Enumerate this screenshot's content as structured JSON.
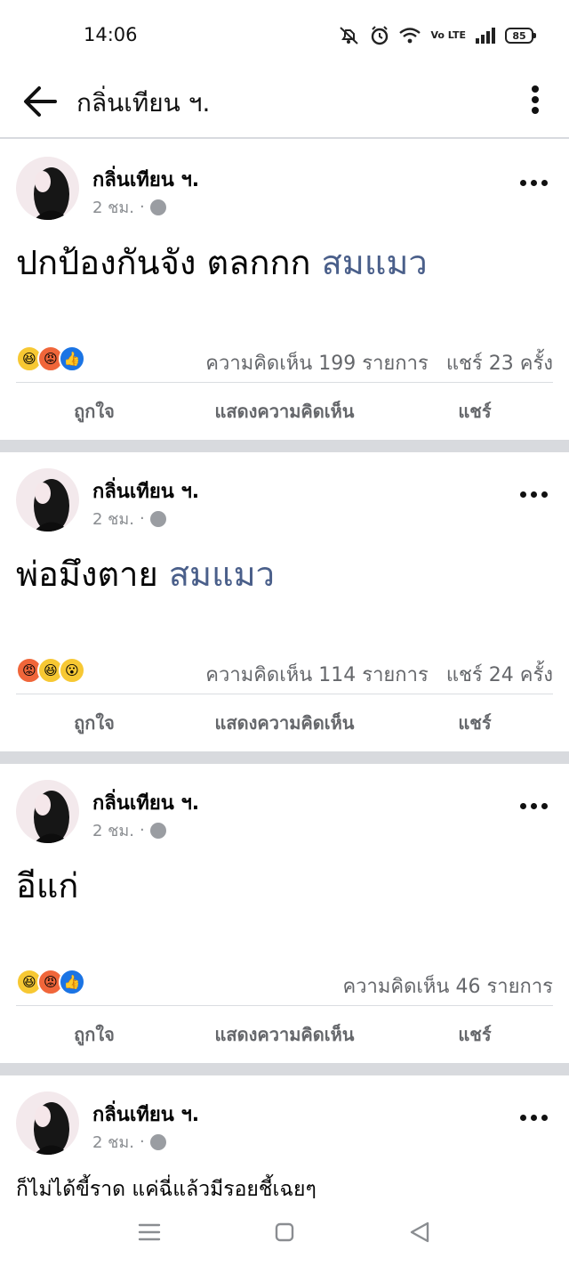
{
  "status_bar": {
    "time": "14:06",
    "battery": "85",
    "network_label": "Vo LTE",
    "icons": [
      "mute-icon",
      "alarm-icon",
      "wifi-icon",
      "volte-icon",
      "signal-icon",
      "battery-icon"
    ]
  },
  "header": {
    "title": "กลิ่นเทียน ฯ.",
    "icons": [
      "back-arrow-icon",
      "more-vertical-icon"
    ]
  },
  "posts": [
    {
      "author": "กลิ่นเทียน ฯ.",
      "time": "2 ชม.",
      "dot": "·",
      "text": "ปกป้องกันจัง ตลกกก ",
      "tag": "สมแมว",
      "reactions": [
        "laugh",
        "angry",
        "like"
      ],
      "comments": "ความคิดเห็น 199 รายการ",
      "shares": "แชร์ 23 ครั้ง"
    },
    {
      "author": "กลิ่นเทียน ฯ.",
      "time": "2 ชม.",
      "dot": "·",
      "text": "พ่อมึงตาย ",
      "tag": "สมแมว",
      "reactions": [
        "angry",
        "laugh",
        "wow"
      ],
      "comments": "ความคิดเห็น 114 รายการ",
      "shares": "แชร์ 24 ครั้ง"
    },
    {
      "author": "กลิ่นเทียน ฯ.",
      "time": "2 ชม.",
      "dot": "·",
      "text": "อีแก่",
      "tag": "",
      "reactions": [
        "laugh",
        "angry",
        "like"
      ],
      "comments": "ความคิดเห็น 46 รายการ",
      "shares": ""
    },
    {
      "author": "กลิ่นเทียน ฯ.",
      "time": "2 ชม.",
      "dot": "·",
      "text": "ก็ไม่ได้ขี้ราด แค่ฉี่แล้วมีรอยชี้เฉยๆ"
    }
  ],
  "actions": {
    "like": "ถูกใจ",
    "comment": "แสดงความคิดเห็น",
    "share": "แชร์"
  },
  "nav_bar": {
    "icons": [
      "menu-icon",
      "home-square-icon",
      "back-triangle-icon"
    ]
  },
  "colors": {
    "tag_link": "#4a5f8a",
    "secondary_text": "#65676b",
    "separator": "#d8dade",
    "like_blue": "#1b74e4",
    "angry_orange": "#f0663a",
    "laugh_yellow": "#f7c833"
  }
}
